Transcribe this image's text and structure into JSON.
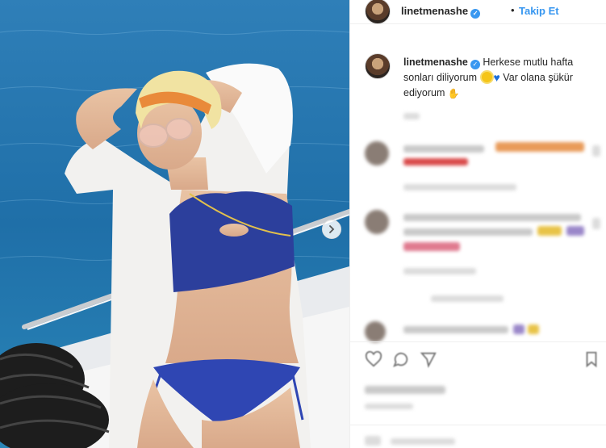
{
  "post": {
    "username": "linetmenashe",
    "dot": "•",
    "follow_label": "Takip Et",
    "caption_user": "linetmenashe",
    "caption_part1": "Herkese mutlu hafta sonları diliyorum",
    "caption_part2": "Var olana şükür ediyorum"
  },
  "icons": {
    "verified": "verified-badge-icon",
    "next": "chevron-right-icon",
    "emoji_sun": "sun-emoji-icon",
    "emoji_heart": "blue-heart-emoji-icon",
    "emoji_pray": "folded-hands-emoji-icon",
    "like": "heart-outline-icon",
    "comment": "speech-bubble-icon",
    "share": "paper-plane-icon",
    "save": "bookmark-icon"
  },
  "colors": {
    "link_blue": "#3897f0",
    "text": "#262626",
    "border": "#efefef"
  }
}
